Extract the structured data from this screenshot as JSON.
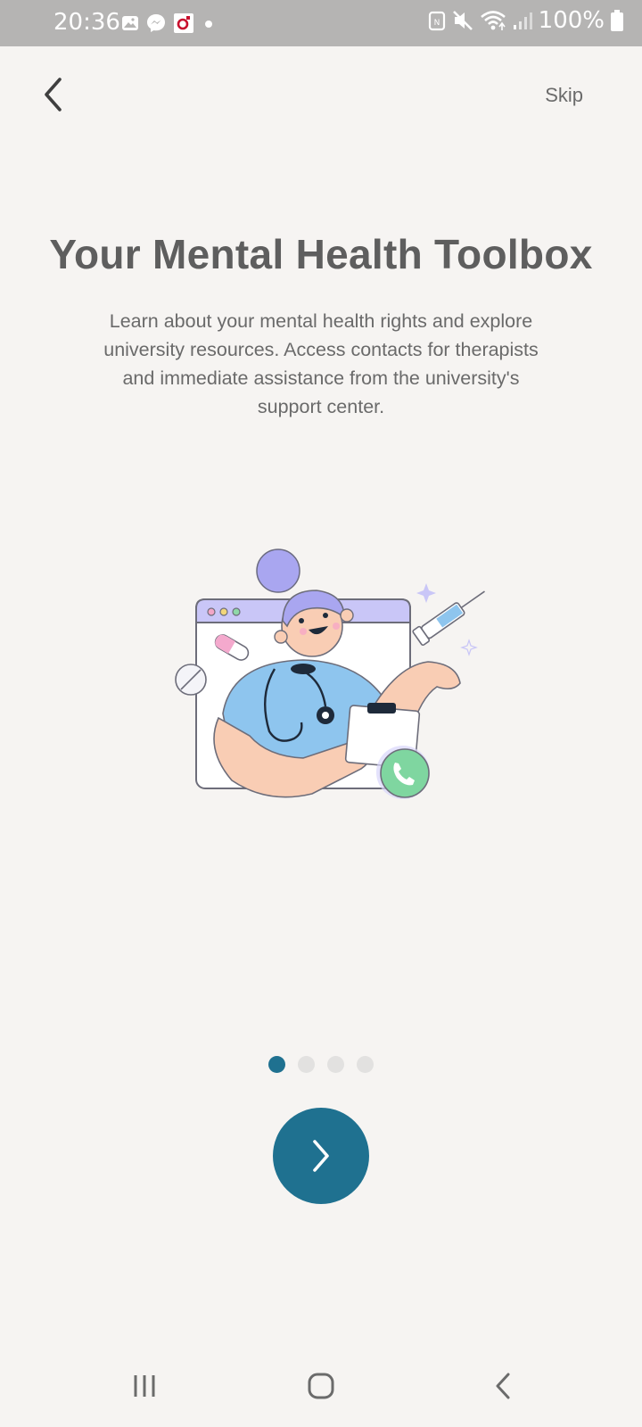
{
  "status_bar": {
    "time": "20:36",
    "battery": "100%",
    "icons": [
      "gallery-icon",
      "messenger-icon",
      "app-notification-icon",
      "dot-icon",
      "nfc-icon",
      "mute-icon",
      "wifi-icon",
      "signal-icon",
      "battery-icon"
    ]
  },
  "nav": {
    "back_icon": "chevron-left-icon",
    "skip_label": "Skip"
  },
  "onboarding": {
    "title": "Your Mental Health Toolbox",
    "description": "Learn about your mental health rights and explore university resources. Access contacts for therapists and immediate assistance from the university's support center.",
    "illustration": "doctor-telehealth-illustration",
    "page_count": 4,
    "current_page": 1,
    "next_icon": "chevron-right-icon"
  },
  "colors": {
    "accent": "#1f7190",
    "background": "#f6f4f2",
    "title": "#5e5e5e",
    "text": "#6a6a6a",
    "dot_inactive": "#e2e1e0"
  },
  "system_nav": {
    "icons": [
      "recent-apps-icon",
      "home-icon",
      "back-icon"
    ]
  }
}
